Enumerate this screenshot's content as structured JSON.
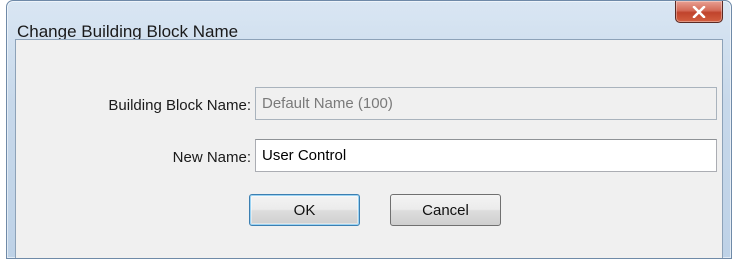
{
  "window": {
    "title": "Change Building Block Name",
    "close_icon": "close-icon"
  },
  "form": {
    "building_block_label": "Building Block Name:",
    "building_block_value": "Default Name (100)",
    "new_name_label": "New Name:",
    "new_name_value": "User Control"
  },
  "buttons": {
    "ok_label": "OK",
    "cancel_label": "Cancel"
  },
  "colors": {
    "close_button": "#c7452d",
    "dialog_background": "#f0f0f0",
    "frame": "#c7d8ea"
  }
}
